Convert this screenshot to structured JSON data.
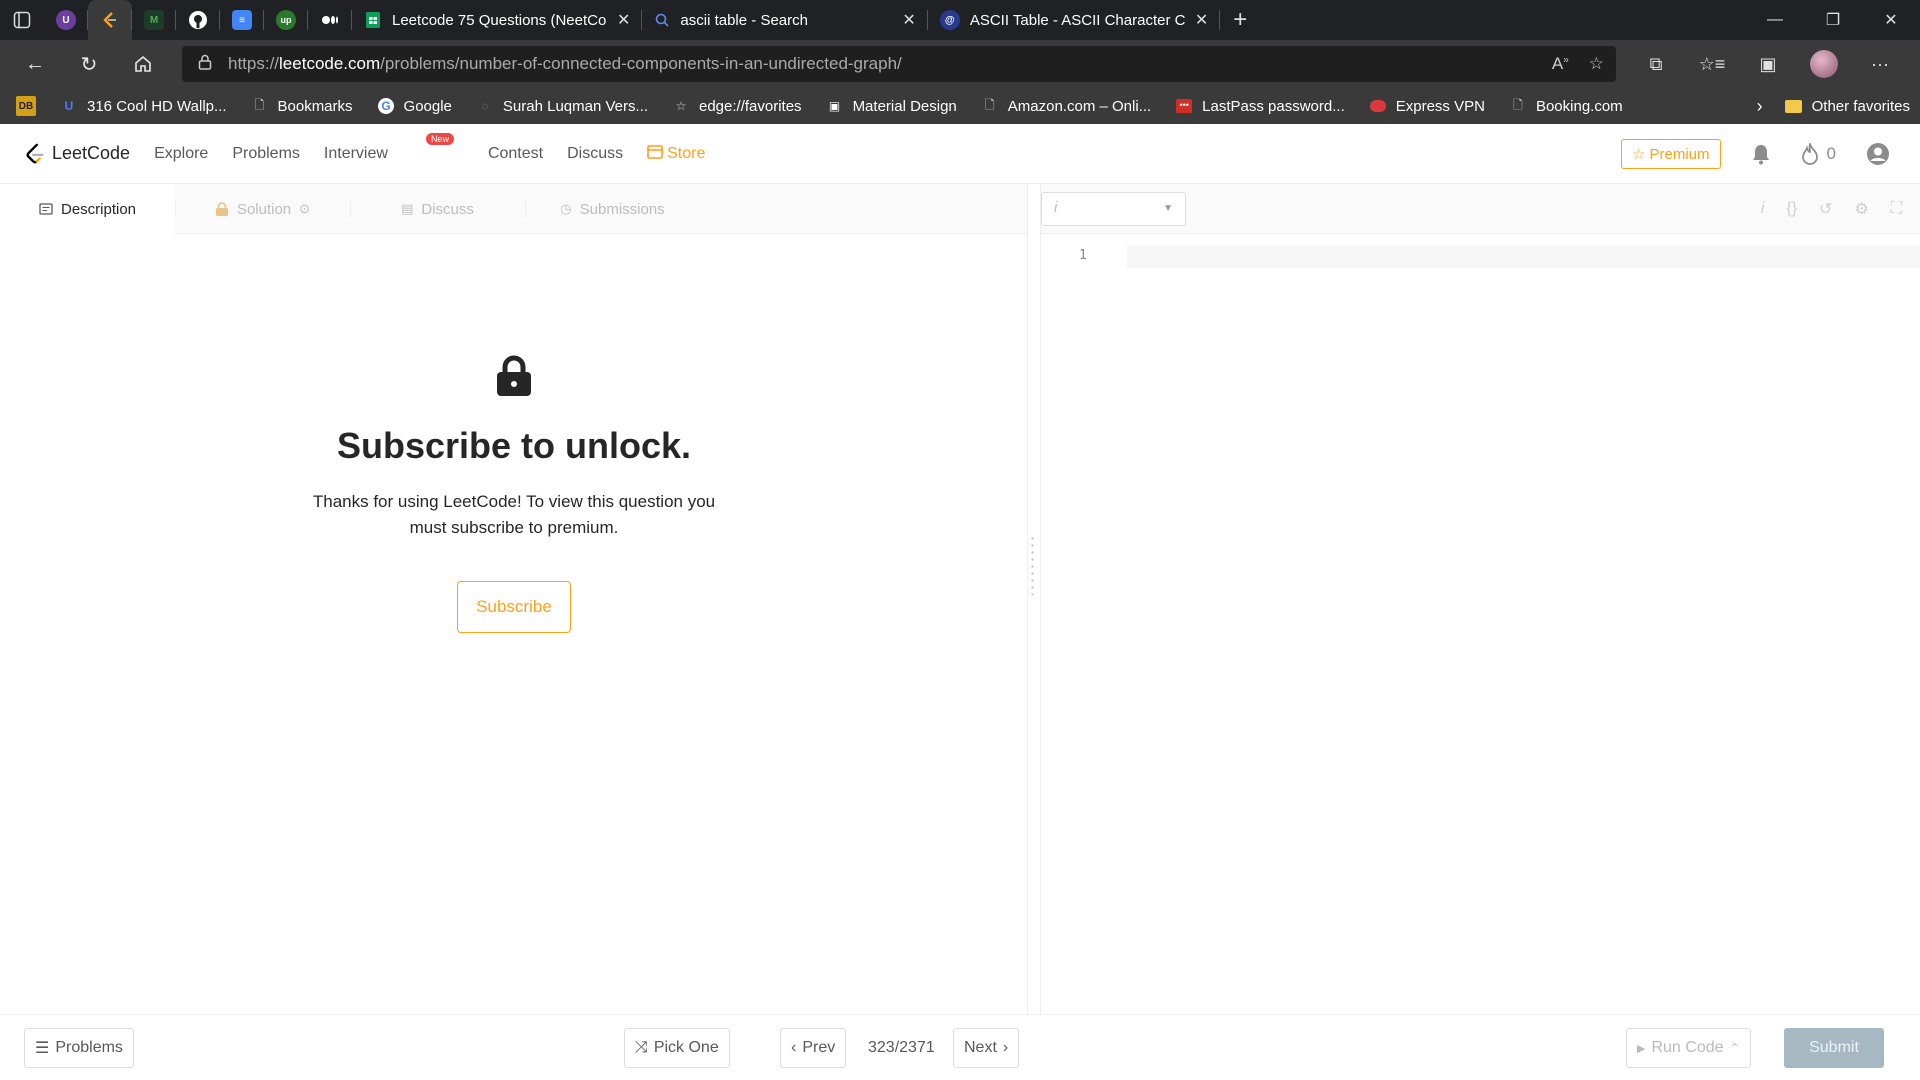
{
  "browser": {
    "tabs": [
      {
        "title": "Leetcode 75 Questions (NeetCo",
        "favicon": "sheets-icon"
      },
      {
        "title": "ascii table - Search",
        "favicon": "search-icon"
      },
      {
        "title": "ASCII Table - ASCII Character Co",
        "favicon": "ascii-icon"
      }
    ],
    "url_scheme": "https://",
    "url_host": "leetcode.com",
    "url_path": "/problems/number-of-connected-components-in-an-undirected-graph/",
    "bookmarks": [
      {
        "label": "316 Cool HD Wallp...",
        "icon": "wallpaper-icon"
      },
      {
        "label": "Bookmarks",
        "icon": "page-icon"
      },
      {
        "label": "Google",
        "icon": "google-icon"
      },
      {
        "label": "Surah Luqman Vers...",
        "icon": "quran-icon"
      },
      {
        "label": "edge://favorites",
        "icon": "star-icon"
      },
      {
        "label": "Material Design",
        "icon": "material-icon"
      },
      {
        "label": "Amazon.com – Onli...",
        "icon": "page-icon"
      },
      {
        "label": "LastPass password...",
        "icon": "lastpass-icon"
      },
      {
        "label": "Express VPN",
        "icon": "vpn-icon"
      },
      {
        "label": "Booking.com",
        "icon": "page-icon"
      }
    ],
    "other_favorites": "Other favorites",
    "badge_db": "DB",
    "badge_up": "up",
    "badge_m": "M"
  },
  "header": {
    "logo": "LeetCode",
    "nav": [
      "Explore",
      "Problems",
      "Interview",
      "Contest",
      "Discuss",
      "Store"
    ],
    "new_badge": "New",
    "premium": "Premium",
    "streak": "0"
  },
  "problem": {
    "tabs": [
      "Description",
      "Solution",
      "Discuss",
      "Submissions"
    ],
    "lock_title": "Subscribe to unlock.",
    "lock_desc": "Thanks for using LeetCode! To view this question you must subscribe to premium.",
    "subscribe": "Subscribe"
  },
  "editor": {
    "lang_placeholder": "i",
    "line_number": "1",
    "toolbar_i": "i",
    "toolbar_braces": "{}"
  },
  "footer": {
    "problems": "Problems",
    "pick_one": "Pick One",
    "prev": "Prev",
    "page": "323/2371",
    "next": "Next",
    "run_code": "Run Code",
    "submit": "Submit"
  },
  "colors": {
    "accent": "#ffa116",
    "submit_disabled": "#a6b9c3"
  }
}
